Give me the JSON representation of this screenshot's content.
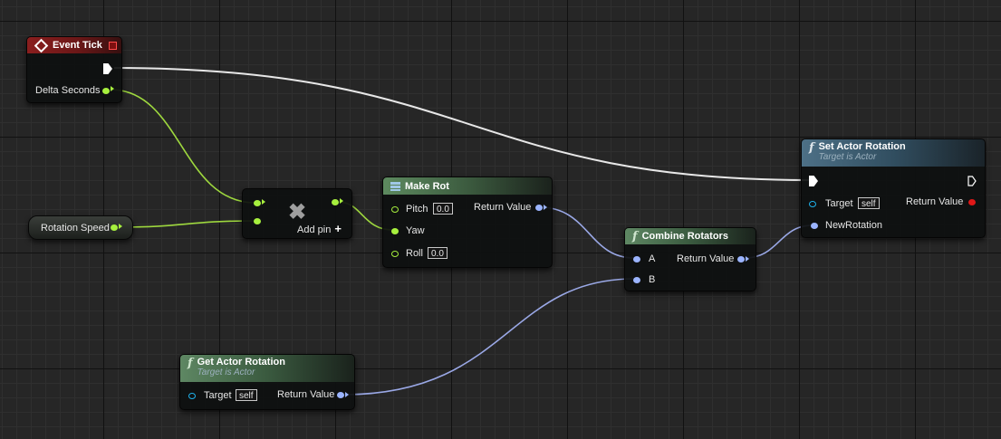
{
  "nodes": {
    "event_tick": {
      "title": "Event Tick",
      "pins": {
        "delta_seconds": "Delta Seconds"
      }
    },
    "set_actor_rotation": {
      "title": "Set Actor Rotation",
      "subtitle": "Target is Actor",
      "pins": {
        "target": "Target",
        "target_default": "self",
        "new_rotation": "NewRotation",
        "return_value": "Return Value"
      }
    },
    "rotation_speed": {
      "label": "Rotation Speed"
    },
    "multiply": {
      "add_pin_label": "Add pin"
    },
    "make_rot": {
      "title": "Make Rot",
      "pins": {
        "pitch": "Pitch",
        "pitch_value": "0.0",
        "yaw": "Yaw",
        "roll": "Roll",
        "roll_value": "0.0",
        "return_value": "Return Value"
      }
    },
    "combine_rotators": {
      "title": "Combine Rotators",
      "pins": {
        "a": "A",
        "b": "B",
        "return_value": "Return Value"
      }
    },
    "get_actor_rotation": {
      "title": "Get Actor Rotation",
      "subtitle": "Target is Actor",
      "pins": {
        "target": "Target",
        "target_default": "self",
        "return_value": "Return Value"
      }
    }
  },
  "colors": {
    "exec": "#ffffff",
    "float_pin": "#a7f03e",
    "rotator_pin": "#9bb4ff",
    "object_pin": "#1fb4ef",
    "event_header": "#8a1e1e",
    "function_header": "#4d7086",
    "pure_header": "#5e8763"
  },
  "icons": {
    "event": "event-diamond-icon",
    "function": "function-f-icon",
    "struct": "make-struct-icon",
    "multiply": "multiply-x-icon",
    "add": "plus-icon"
  }
}
